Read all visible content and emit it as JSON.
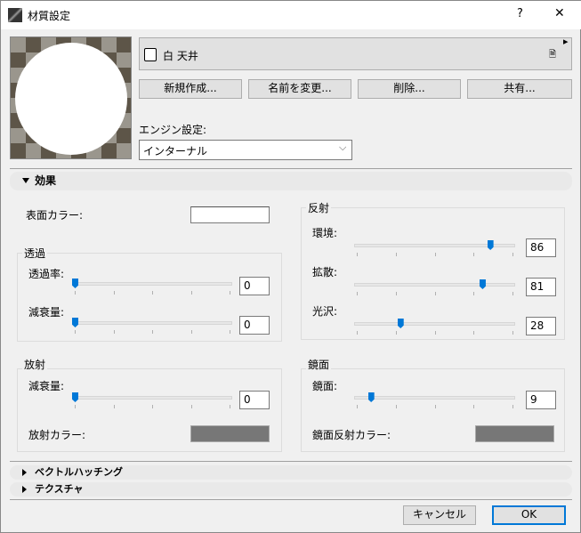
{
  "window": {
    "title": "材質設定",
    "help": "?",
    "close": "✕"
  },
  "material": {
    "name": "白 天井",
    "menu_arrow": "▸",
    "doc_icon": "🗎"
  },
  "buttons": {
    "new": "新規作成...",
    "rename": "名前を変更...",
    "delete": "削除...",
    "share": "共有..."
  },
  "engine": {
    "label": "エンジン設定:",
    "value": "インターナル"
  },
  "sections": {
    "effects": "効果",
    "vector_hatching": "ベクトルハッチング",
    "texture": "テクスチャ"
  },
  "surface_color": {
    "label": "表面カラー:",
    "color": "#ffffff"
  },
  "transparency": {
    "title": "透過",
    "rate_label": "透過率:",
    "rate": 0,
    "falloff_label": "減衰量:",
    "falloff": 0
  },
  "reflection": {
    "title": "反射",
    "ambient_label": "環境:",
    "ambient": 86,
    "diffuse_label": "拡散:",
    "diffuse": 81,
    "shine_label": "光沢:",
    "shine": 28
  },
  "emission": {
    "title": "放射",
    "falloff_label": "減衰量:",
    "falloff": 0,
    "color_label": "放射カラー:",
    "color": "#777777"
  },
  "specular": {
    "title": "鏡面",
    "value_label": "鏡面:",
    "value": 9,
    "color_label": "鏡面反射カラー:",
    "color": "#777777"
  },
  "footer": {
    "cancel": "キャンセル",
    "ok": "OK"
  }
}
